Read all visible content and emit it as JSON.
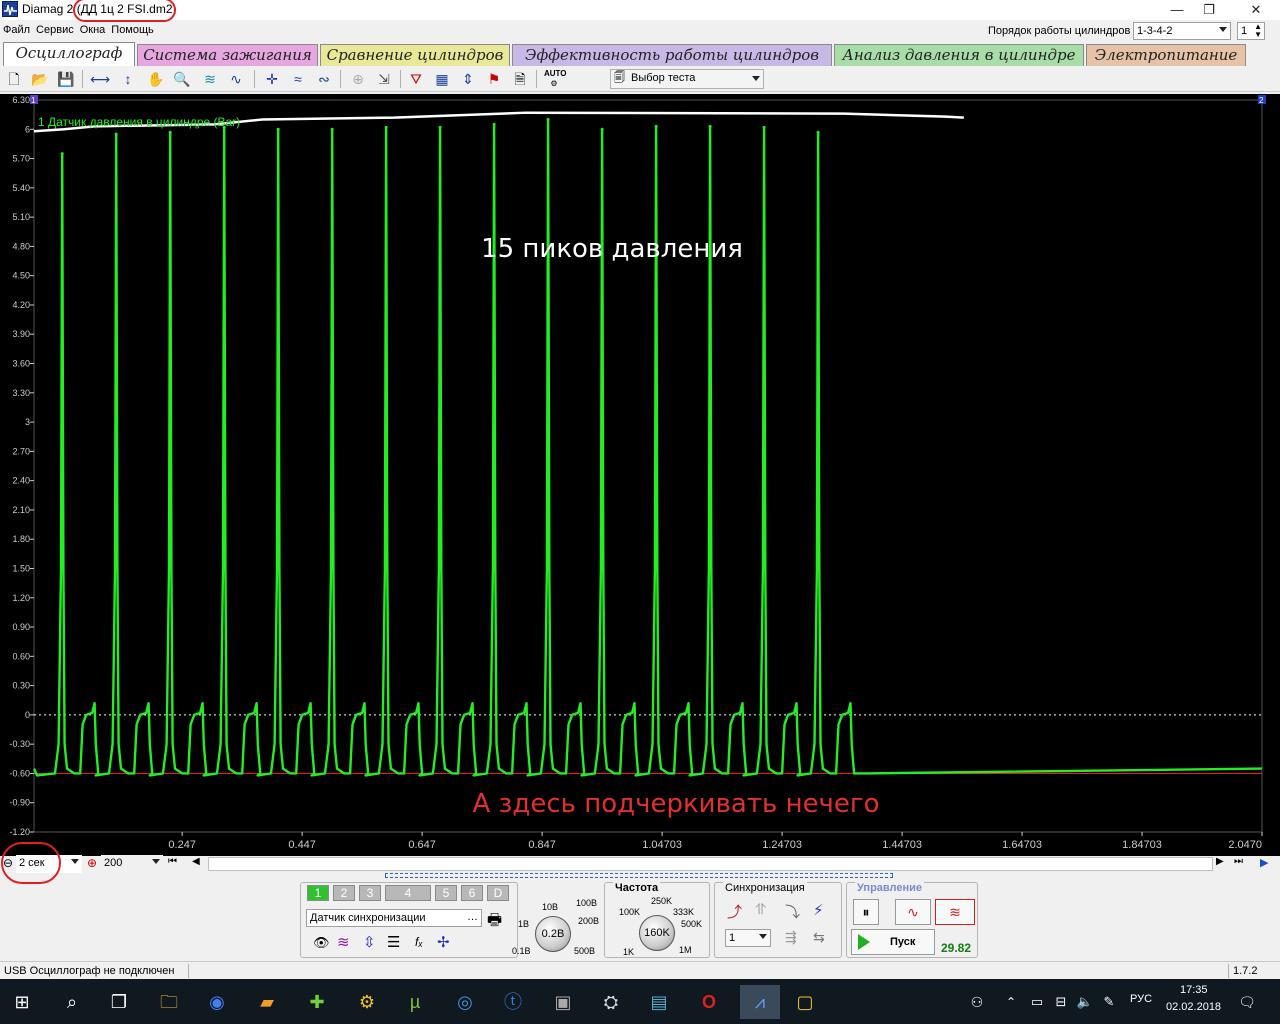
{
  "window": {
    "app_name": "Diamag 2",
    "file_name": "ДД 1ц 2 FSI.dm2"
  },
  "window_buttons": {
    "minimize": "—",
    "restore": "❐",
    "close": "✕"
  },
  "menu": [
    "Файл",
    "Сервис",
    "Окна",
    "Помощь"
  ],
  "cylinder_order": {
    "label": "Порядок работы цилиндров",
    "value": "1-3-4-2",
    "count": "1"
  },
  "tabs": [
    {
      "label": "Осциллограф",
      "color": "#ffffff",
      "active": true
    },
    {
      "label": "Система зажигания",
      "color": "#e6a6e0"
    },
    {
      "label": "Сравнение цилиндров",
      "color": "#e8e898"
    },
    {
      "label": "Эффективность работы цилиндров",
      "color": "#c8b8e6"
    },
    {
      "label": "Анализ давления в цилиндре",
      "color": "#a8dca8"
    },
    {
      "label": "Электропитание",
      "color": "#e6c2a6"
    }
  ],
  "toolbar": {
    "test_select": "Выбор теста",
    "auto_label": "AUTO"
  },
  "plot": {
    "channel_label": "1 Датчик давления в цилиндре (Bar)",
    "annotation_top": "15 пиков давления",
    "annotation_bottom": "А здесь подчеркивать нечего",
    "marker_left": "1",
    "marker_right": "2",
    "colors": {
      "trace": "#22ee22",
      "envelope": "#ffffff",
      "baseline": "#dd2020",
      "zero_line": "#ffffff",
      "grid": "#3a3a3a",
      "tick_text": "#cccccc",
      "annotation_top": "#ffffff",
      "annotation_bottom": "#e03030"
    }
  },
  "chart_data": {
    "type": "line",
    "title": "",
    "xlabel": "",
    "ylabel": "",
    "series": [
      {
        "name": "1 Датчик давления в цилиндре (Bar)",
        "peak_x": [
          0.047,
          0.137,
          0.227,
          0.317,
          0.407,
          0.497,
          0.587,
          0.677,
          0.767,
          0.857,
          0.947,
          1.037,
          1.127,
          1.217,
          1.307
        ],
        "peak_y": [
          5.75,
          5.95,
          5.97,
          6.02,
          6.0,
          6.0,
          6.02,
          6.02,
          6.05,
          6.1,
          6.0,
          6.03,
          6.03,
          6.02,
          5.97
        ]
      }
    ],
    "envelope": {
      "x": [
        0.0,
        0.05,
        0.1,
        0.3,
        0.38,
        0.6,
        0.82,
        1.35,
        1.52,
        1.55
      ],
      "y": [
        5.98,
        6.0,
        6.03,
        6.05,
        6.1,
        6.12,
        6.17,
        6.16,
        6.13,
        6.12
      ]
    },
    "baseline_level": -0.6,
    "x_ticks": [
      "0.247",
      "0.447",
      "0.647",
      "0.847",
      "1.04703",
      "1.24703",
      "1.44703",
      "1.64703",
      "1.84703",
      "2.0470"
    ],
    "x_tick_values": [
      0.247,
      0.447,
      0.647,
      0.847,
      1.04703,
      1.24703,
      1.44703,
      1.64703,
      1.84703,
      2.047
    ],
    "y_ticks": [
      "6.30",
      "6",
      "5.70",
      "5.40",
      "5.10",
      "4.80",
      "4.50",
      "4.20",
      "3.90",
      "3.60",
      "3.30",
      "3",
      "2.70",
      "2.40",
      "2.10",
      "1.80",
      "1.50",
      "1.20",
      "0.90",
      "0.60",
      "0.30",
      "0",
      "-0.30",
      "-0.60",
      "-0.90",
      "-1.20"
    ],
    "y_tick_values": [
      6.3,
      6.0,
      5.7,
      5.4,
      5.1,
      4.8,
      4.5,
      4.2,
      3.9,
      3.6,
      3.3,
      3.0,
      2.7,
      2.4,
      2.1,
      1.8,
      1.5,
      1.2,
      0.9,
      0.6,
      0.3,
      0.0,
      -0.3,
      -0.6,
      -0.9,
      -1.2
    ],
    "xlim": [
      0.0,
      2.047
    ],
    "ylim": [
      -1.2,
      6.3
    ],
    "grid": true,
    "legend": "top-left"
  },
  "time_controls": {
    "time_base": "2 сек",
    "zoom": "200"
  },
  "panel": {
    "channels": [
      "1",
      "2",
      "3",
      "4",
      "5",
      "6",
      "D"
    ],
    "sync_source": "Датчик синхронизации",
    "voltage_scale": [
      "100B",
      "10B",
      "200B",
      "1B",
      "0.1B",
      "500B"
    ],
    "voltage_value": "0.2B",
    "freq_title": "Частота",
    "freq_scale": [
      "250K",
      "100K",
      "333K",
      "500K",
      "1K",
      "1M"
    ],
    "freq_value": "160K",
    "sync_title": "Синхронизация",
    "sync_channel": "1",
    "control_title": "Управление",
    "start_label": "Пуск",
    "rate_value": "29.82"
  },
  "status": {
    "text": "USB Осциллограф не подключен",
    "version": "1.7.2"
  },
  "taskbar": {
    "lang": "РУС",
    "time": "17:35",
    "date": "02.02.2018"
  }
}
